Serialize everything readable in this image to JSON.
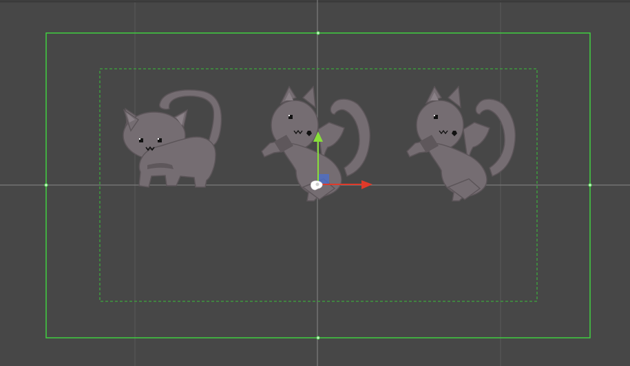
{
  "scene": {
    "background_color": "#474747",
    "grid_line_color": "#5a5a5a",
    "axis_line_color": "#7a7a7a",
    "frame_color": "#3fcf3f",
    "safe_area_color": "#3fa83f",
    "handle_color": "#b8e8b8"
  },
  "sprites": [
    {
      "name": "cat-sit",
      "pose": "sitting",
      "icon": "cat-icon"
    },
    {
      "name": "cat-jump-selected",
      "pose": "jumping",
      "icon": "cat-icon",
      "selected": true
    },
    {
      "name": "cat-jump",
      "pose": "jumping",
      "icon": "cat-icon"
    }
  ],
  "gizmo": {
    "tool": "move",
    "x_axis_color": "#e03a2a",
    "y_axis_color": "#88e03a",
    "plane_handle_color": "#4a6fd0",
    "pivot_color": "#ffffff"
  },
  "cat": {
    "fill": "#756d72",
    "outline": "#5c5559",
    "shade": "#5e575b",
    "eye": "#111111"
  }
}
